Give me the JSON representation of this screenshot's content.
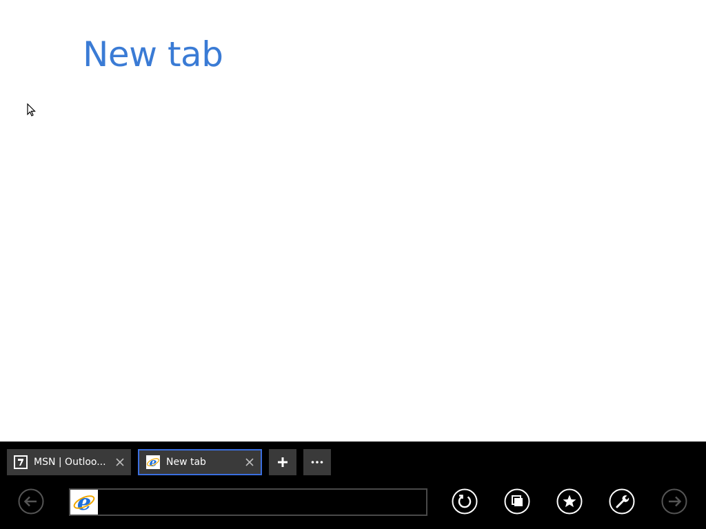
{
  "page": {
    "title": "New tab"
  },
  "tabs": [
    {
      "label": "MSN | Outloo...",
      "favicon": "outlook-icon",
      "active": false
    },
    {
      "label": "New tab",
      "favicon": "ie-icon",
      "active": true
    }
  ],
  "toolbar": {
    "new_tab_icon": "plus-icon",
    "more_icon": "ellipsis-icon",
    "back_icon": "back-arrow-icon",
    "forward_icon": "forward-arrow-icon",
    "refresh_icon": "refresh-icon",
    "tabs_icon": "tabs-icon",
    "favorites_icon": "star-icon",
    "tools_icon": "wrench-icon"
  },
  "address_bar": {
    "value": "",
    "placeholder": ""
  },
  "colors": {
    "accent": "#3a7bd5",
    "active_tab_border": "#3b6fe0",
    "bar_background": "#000000",
    "tab_background": "#3a3a3a"
  }
}
